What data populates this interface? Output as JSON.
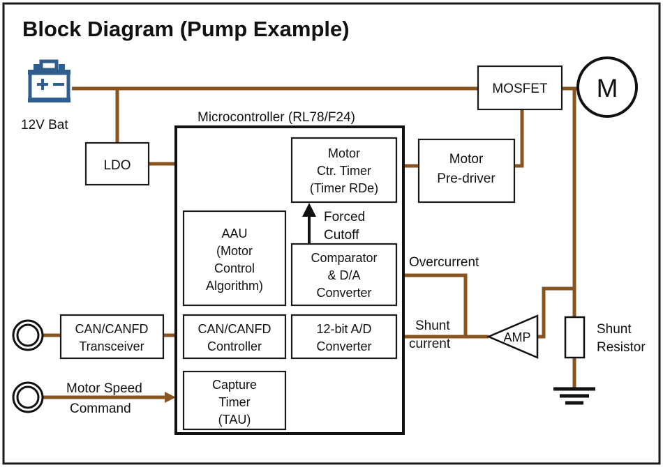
{
  "title": "Block Diagram (Pump Example)",
  "power": {
    "battery_icon": "battery-icon",
    "battery_label": "12V Bat",
    "ldo_label": "LDO"
  },
  "microcontroller": {
    "caption": "Microcontroller (RL78/F24)",
    "blocks": [
      {
        "name": "motor-ctr-timer",
        "lines": [
          "Motor",
          "Ctr. Timer",
          "(Timer RDe)"
        ]
      },
      {
        "name": "aau",
        "lines": [
          "AAU",
          "(Motor",
          "Control",
          "Algorithm)"
        ]
      },
      {
        "name": "comparator-da",
        "lines": [
          "Comparator",
          "& D/A",
          "Converter"
        ]
      },
      {
        "name": "can-canfd-controller",
        "lines": [
          "CAN/CANFD",
          "Controller"
        ]
      },
      {
        "name": "ad-converter",
        "lines": [
          "12-bit A/D",
          "Converter"
        ]
      },
      {
        "name": "capture-timer",
        "lines": [
          "Capture",
          "Timer",
          "(TAU)"
        ]
      }
    ],
    "internal_signal": {
      "lines": [
        "Forced",
        "Cutoff"
      ]
    }
  },
  "external": {
    "mosfet_label": "MOSFET",
    "motor_label": "M",
    "pre_driver_lines": [
      "Motor",
      "Pre-driver"
    ],
    "transceiver_lines": [
      "CAN/CANFD",
      "Transceiver"
    ],
    "amp_label": "AMP",
    "shunt_resistor_lines": [
      "Shunt",
      "Resistor"
    ]
  },
  "signals": {
    "overcurrent": "Overcurrent",
    "shunt_current_lines": [
      "Shunt",
      "current"
    ],
    "motor_speed_command_lines": [
      "Motor Speed",
      "Command"
    ]
  },
  "colors": {
    "wire": "#8a5420",
    "battery": "#2f5d8d",
    "outline": "#111111",
    "background": "#ffffff"
  }
}
